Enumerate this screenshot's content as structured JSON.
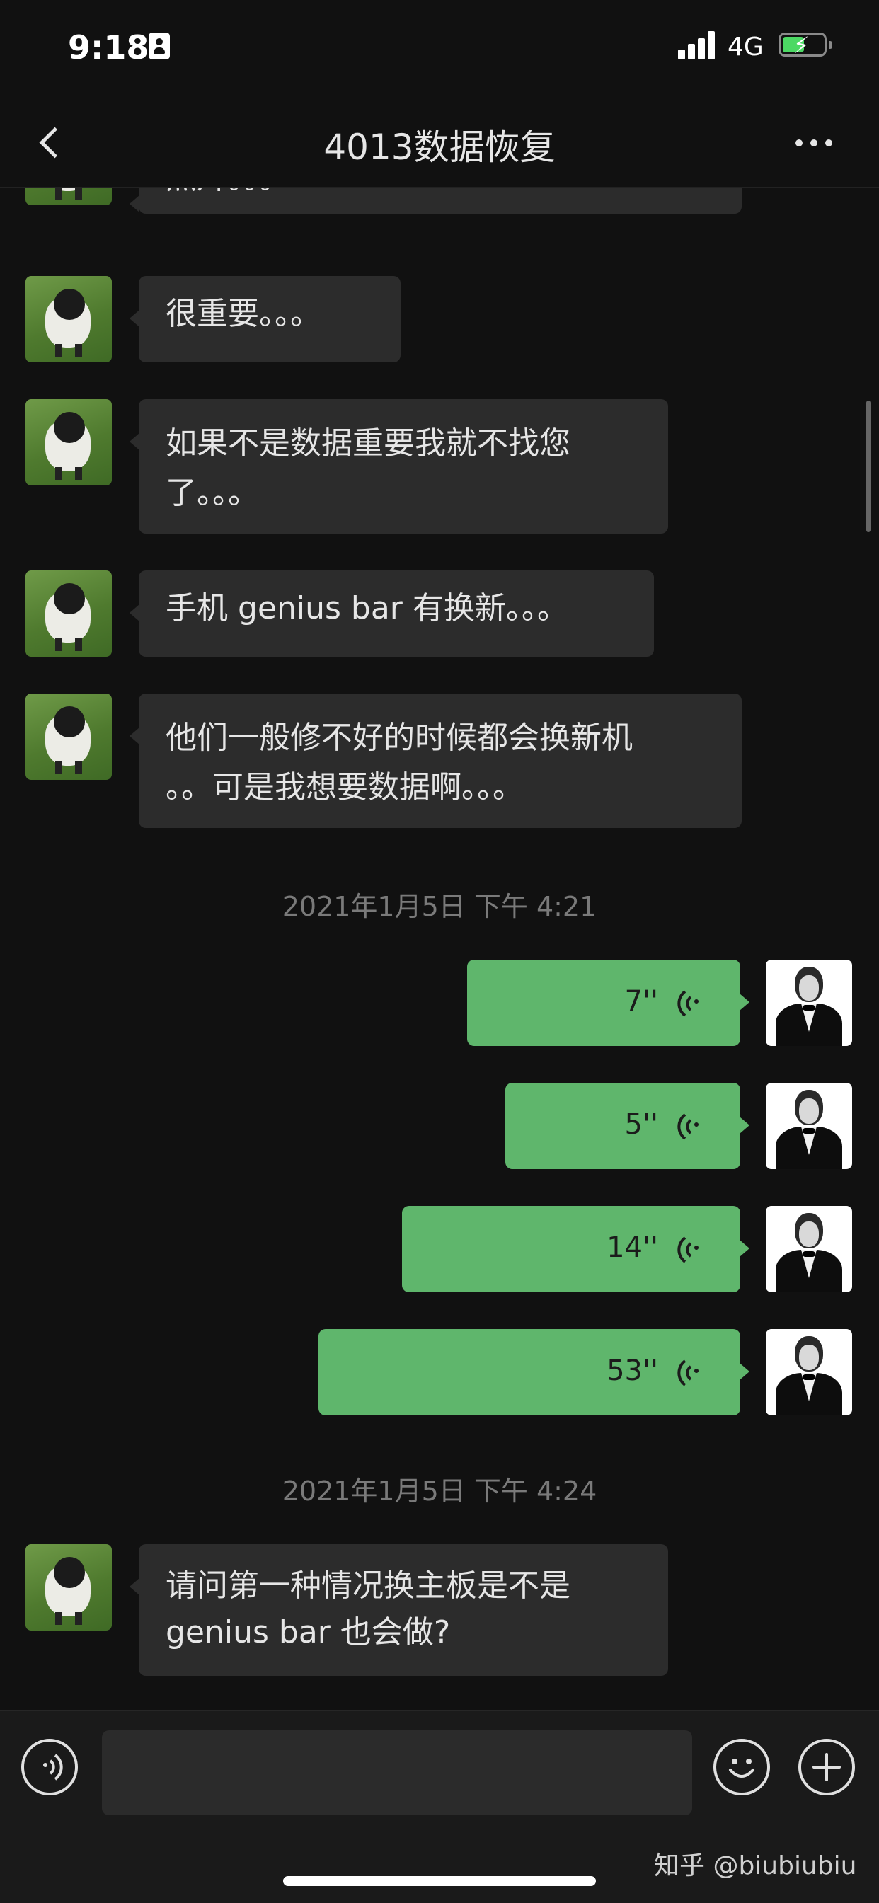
{
  "status_bar": {
    "time": "9:18",
    "network": "4G"
  },
  "header": {
    "title": "4013数据恢复"
  },
  "messages_in": [
    {
      "lines": [
        "照片。。。"
      ]
    },
    {
      "lines": [
        "很重要。。。"
      ]
    },
    {
      "lines": [
        "如果不是数据重要我就不找您",
        "了。。。"
      ]
    },
    {
      "lines": [
        "手机 genius bar 有换新。。。"
      ]
    },
    {
      "lines": [
        "他们一般修不好的时候都会换新机",
        "。。可是我想要数据啊。。。"
      ]
    },
    {
      "lines": [
        "请问第一种情况换主板是不是",
        "genius bar 也会做?"
      ]
    }
  ],
  "timestamps": [
    "2021年1月5日 下午 4:21",
    "2021年1月5日 下午 4:24"
  ],
  "voice_messages": [
    {
      "duration": "7''"
    },
    {
      "duration": "5''"
    },
    {
      "duration": "14''"
    },
    {
      "duration": "53''"
    }
  ],
  "input_bar": {
    "placeholder": ""
  },
  "watermark": "知乎 @biubiubiu"
}
